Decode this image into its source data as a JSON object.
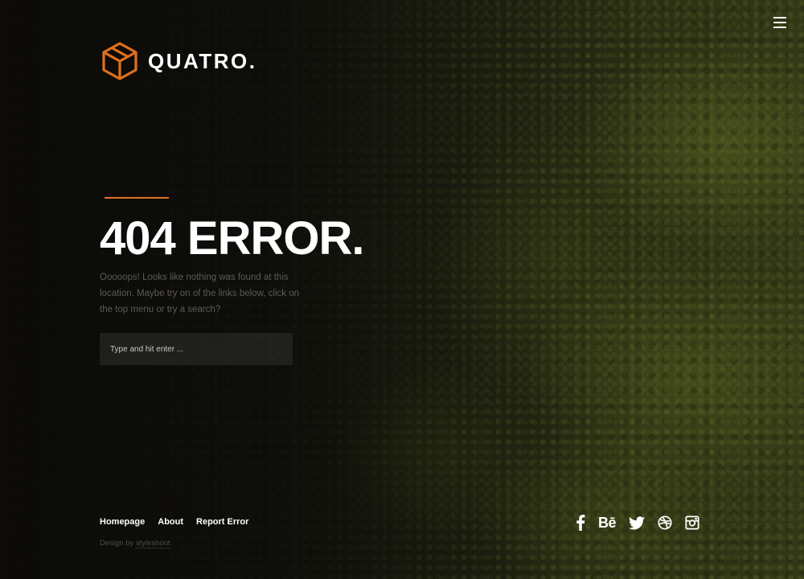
{
  "brand": {
    "name": "QUATRO.",
    "logo_icon": "cube-logo-icon"
  },
  "menu": {
    "icon": "hamburger-menu-icon"
  },
  "main": {
    "heading": "404 ERROR.",
    "lead": "Ooooops! Looks like nothing was found at this location. Maybe try on of the links below, click on the top menu or try a search?"
  },
  "search": {
    "placeholder": "Type and hit enter ...",
    "value": ""
  },
  "footer": {
    "links": [
      {
        "label": "Homepage"
      },
      {
        "label": "About"
      },
      {
        "label": "Report Error"
      }
    ],
    "credit_prefix": "Design by",
    "credit_link": "styleshout"
  },
  "social": {
    "icons": [
      "facebook-icon",
      "behance-icon",
      "twitter-icon",
      "dribbble-icon",
      "instagram-icon"
    ],
    "behance_text": "Bē"
  },
  "colors": {
    "accent": "#e0701c",
    "background": "#0b0a08",
    "text": "#ffffff",
    "muted_text": "#5c5a55"
  }
}
